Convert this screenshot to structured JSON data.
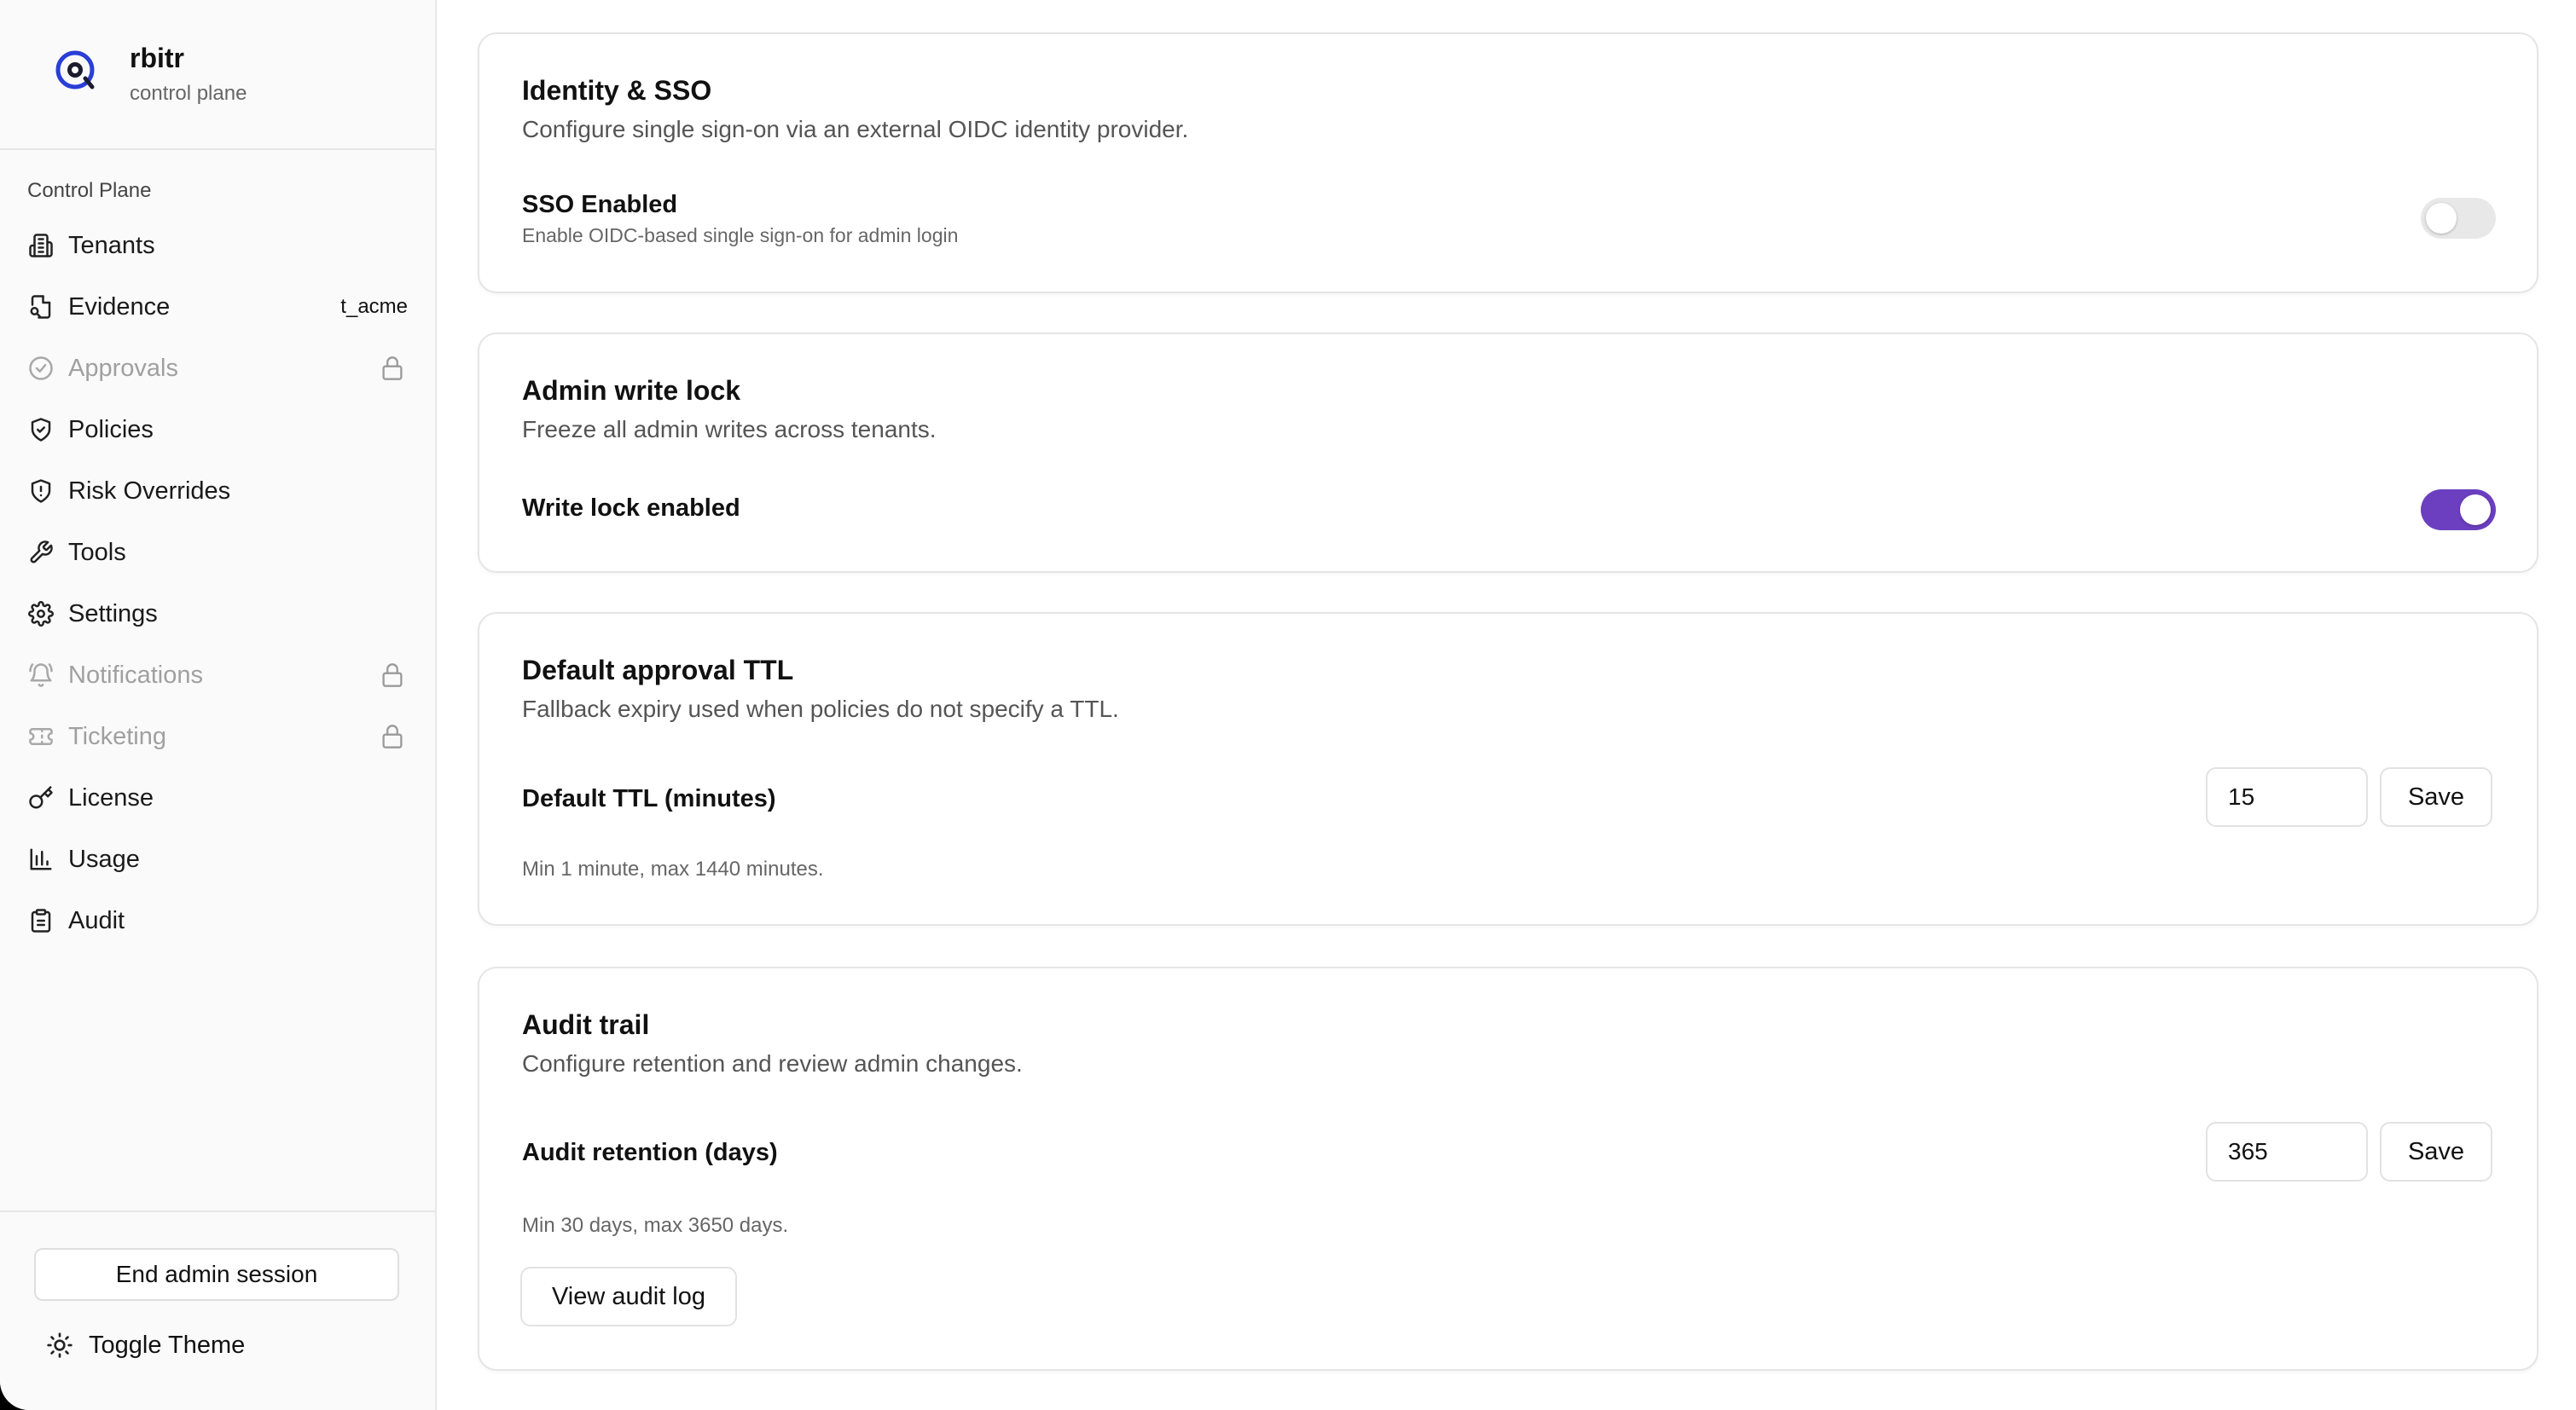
{
  "brand": {
    "name": "rbitr",
    "subtitle": "control plane"
  },
  "sidebar": {
    "section_label": "Control Plane",
    "items": [
      {
        "label": "Tenants",
        "icon": "building-icon",
        "disabled": false
      },
      {
        "label": "Evidence",
        "icon": "file-search-icon",
        "disabled": false,
        "trail": "t_acme"
      },
      {
        "label": "Approvals",
        "icon": "check-circle-icon",
        "disabled": true,
        "locked": true
      },
      {
        "label": "Policies",
        "icon": "shield-check-icon",
        "disabled": false
      },
      {
        "label": "Risk Overrides",
        "icon": "shield-alert-icon",
        "disabled": false
      },
      {
        "label": "Tools",
        "icon": "wrench-icon",
        "disabled": false
      },
      {
        "label": "Settings",
        "icon": "gear-icon",
        "disabled": false
      },
      {
        "label": "Notifications",
        "icon": "bell-icon",
        "disabled": true,
        "locked": true
      },
      {
        "label": "Ticketing",
        "icon": "ticket-icon",
        "disabled": true,
        "locked": true
      },
      {
        "label": "License",
        "icon": "key-icon",
        "disabled": false
      },
      {
        "label": "Usage",
        "icon": "bar-chart-icon",
        "disabled": false
      },
      {
        "label": "Audit",
        "icon": "clipboard-icon",
        "disabled": false
      }
    ],
    "end_session_label": "End admin session",
    "toggle_theme_label": "Toggle Theme"
  },
  "cards": {
    "sso": {
      "title": "Identity & SSO",
      "description": "Configure single sign-on via an external OIDC identity provider.",
      "setting_label": "SSO Enabled",
      "setting_sub": "Enable OIDC-based single sign-on for admin login",
      "enabled": false
    },
    "write_lock": {
      "title": "Admin write lock",
      "description": "Freeze all admin writes across tenants.",
      "setting_label": "Write lock enabled",
      "enabled": true
    },
    "ttl": {
      "title": "Default approval TTL",
      "description": "Fallback expiry used when policies do not specify a TTL.",
      "field_label": "Default TTL (minutes)",
      "value": "15",
      "save_label": "Save",
      "hint": "Min 1 minute, max 1440 minutes."
    },
    "audit": {
      "title": "Audit trail",
      "description": "Configure retention and review admin changes.",
      "field_label": "Audit retention (days)",
      "value": "365",
      "save_label": "Save",
      "hint": "Min 30 days, max 3650 days.",
      "view_log_label": "View audit log"
    }
  },
  "colors": {
    "accent": "#6b3fc0",
    "logo_blue": "#2a3fd6",
    "toggle_off": "#e8e8e8"
  }
}
